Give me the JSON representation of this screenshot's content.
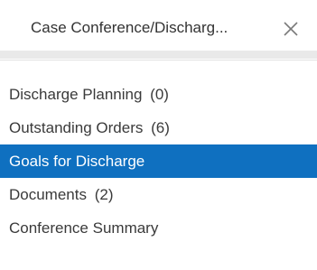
{
  "tab": {
    "title": "Case Conference/Discharg...",
    "close_icon": "close-icon"
  },
  "nav": {
    "items": [
      {
        "label": "Discharge Planning",
        "count": "(0)",
        "active": false
      },
      {
        "label": "Outstanding Orders",
        "count": "(6)",
        "active": false
      },
      {
        "label": "Goals for Discharge",
        "count": "",
        "active": true
      },
      {
        "label": "Documents",
        "count": "(2)",
        "active": false
      },
      {
        "label": "Conference Summary",
        "count": "",
        "active": false
      }
    ]
  },
  "colors": {
    "active_bg": "#0f70c0",
    "active_text": "#ffffff",
    "text": "#3a3a3a"
  }
}
